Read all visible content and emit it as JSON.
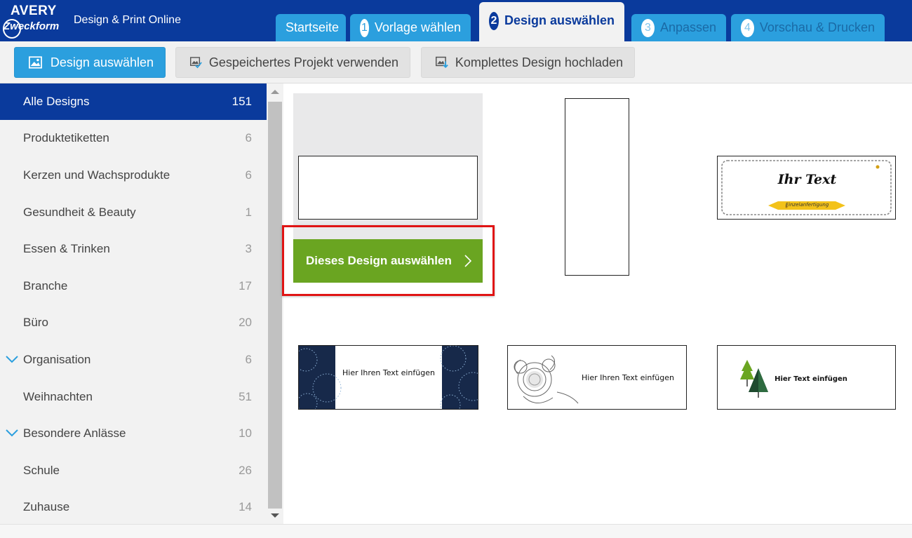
{
  "header": {
    "logo_line1": "AVERY",
    "logo_line2": "Zweckform",
    "app_title": "Design & Print Online",
    "tabs": [
      {
        "num": "",
        "label": "Startseite"
      },
      {
        "num": "1",
        "label": "Vorlage wählen"
      },
      {
        "num": "2",
        "label": "Design auswählen"
      },
      {
        "num": "3",
        "label": "Anpassen"
      },
      {
        "num": "4",
        "label": "Vorschau & Drucken"
      }
    ]
  },
  "toolbar": {
    "design_select": "Design auswählen",
    "saved_project": "Gespeichertes Projekt verwenden",
    "upload_design": "Komplettes Design hochladen"
  },
  "sidebar": {
    "categories": [
      {
        "name": "Alle Designs",
        "count": "151"
      },
      {
        "name": "Produktetiketten",
        "count": "6"
      },
      {
        "name": "Kerzen und Wachsprodukte",
        "count": "6"
      },
      {
        "name": "Gesundheit & Beauty",
        "count": "1"
      },
      {
        "name": "Essen & Trinken",
        "count": "3"
      },
      {
        "name": "Branche",
        "count": "17"
      },
      {
        "name": "Büro",
        "count": "20"
      },
      {
        "name": "Organisation",
        "count": "6"
      },
      {
        "name": "Weihnachten",
        "count": "51"
      },
      {
        "name": "Besondere Anlässe",
        "count": "10"
      },
      {
        "name": "Schule",
        "count": "26"
      },
      {
        "name": "Zuhause",
        "count": "14"
      }
    ]
  },
  "gallery": {
    "select_button": "Dieses Design auswählen",
    "designs": {
      "script": {
        "title": "Ihr Text",
        "ribbon": "Einzelanfertigung"
      },
      "navy": {
        "text": "Hier Ihren Text einfügen"
      },
      "floral": {
        "text": "Hier Ihren Text einfügen"
      },
      "tree": {
        "text": "Hier Text einfügen"
      }
    }
  },
  "colors": {
    "header_bg": "#0a3a9c",
    "tab_bg": "#2b9fde",
    "select_green": "#6aa521",
    "highlight_red": "#e01414"
  }
}
